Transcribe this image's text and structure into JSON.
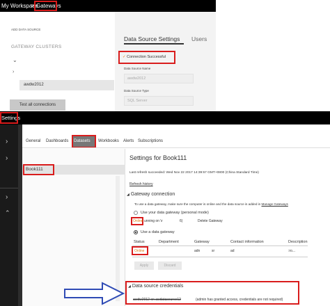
{
  "top_header": {
    "workspace": "My Workspace",
    "separator": ">",
    "current": "Gateways"
  },
  "gateway_panel": {
    "add_data_source": "ADD DATA SOURCE",
    "gateway_clusters": "GATEWAY CLUSTERS",
    "selected_source": "awdw2012",
    "test_all_button": "Test all connections"
  },
  "ds_settings": {
    "tabs": [
      "Data Source Settings",
      "Users"
    ],
    "connection_status": "Connection Successful",
    "check_mark": "✓",
    "name_label": "Data Source Name",
    "name_value": "awdw2012",
    "type_label": "Data Source Type",
    "type_value": "SQL Server"
  },
  "settings_header": {
    "title": "Settings"
  },
  "settings_tabs": [
    "General",
    "Dashboards",
    "Datasets",
    "Workbooks",
    "Alerts",
    "Subscriptions"
  ],
  "dataset_list": {
    "selected": "Book111"
  },
  "dataset_settings": {
    "title": "Settings for Book111",
    "last_refresh": "Last refresh succeeded: Wed Nov 22 2017 14:39:57 GMT+0800 (China Standard Time)",
    "refresh_history": "Refresh history",
    "gateway_section": "Gateway connection",
    "gateway_desc_prefix": "To use a data gateway, make sure the computer is online and the data source is added in",
    "manage_gateways": "Manage Gateways",
    "personal_option": "Use your data gateway (personal mode)",
    "online_personal": "Online",
    "running_on": "unning on \\r",
    "row_number": "6)",
    "delete_gateway": "Delete Gateway",
    "use_gateway_option": "Use a data gateway",
    "table_headers": [
      "Status",
      "Department",
      "Gateway",
      "Contact information",
      "Description"
    ],
    "table_row": {
      "status": "Online",
      "gateway": "adn",
      "gateway2": "sr",
      "contact": "ad",
      "description": ":ro..."
    },
    "apply_button": "Apply",
    "discard_button": "Discard",
    "credentials_section": "Data source credentials",
    "credentials_text": "awdw2012 on awdatasource12",
    "credentials_note": "(admin has granted access, credentials are not required)"
  },
  "colors": {
    "red_box": "#d91c1c",
    "black_bar": "#000000",
    "online_orange": "#e07a10",
    "arrow_blue": "#2f4bb5"
  }
}
